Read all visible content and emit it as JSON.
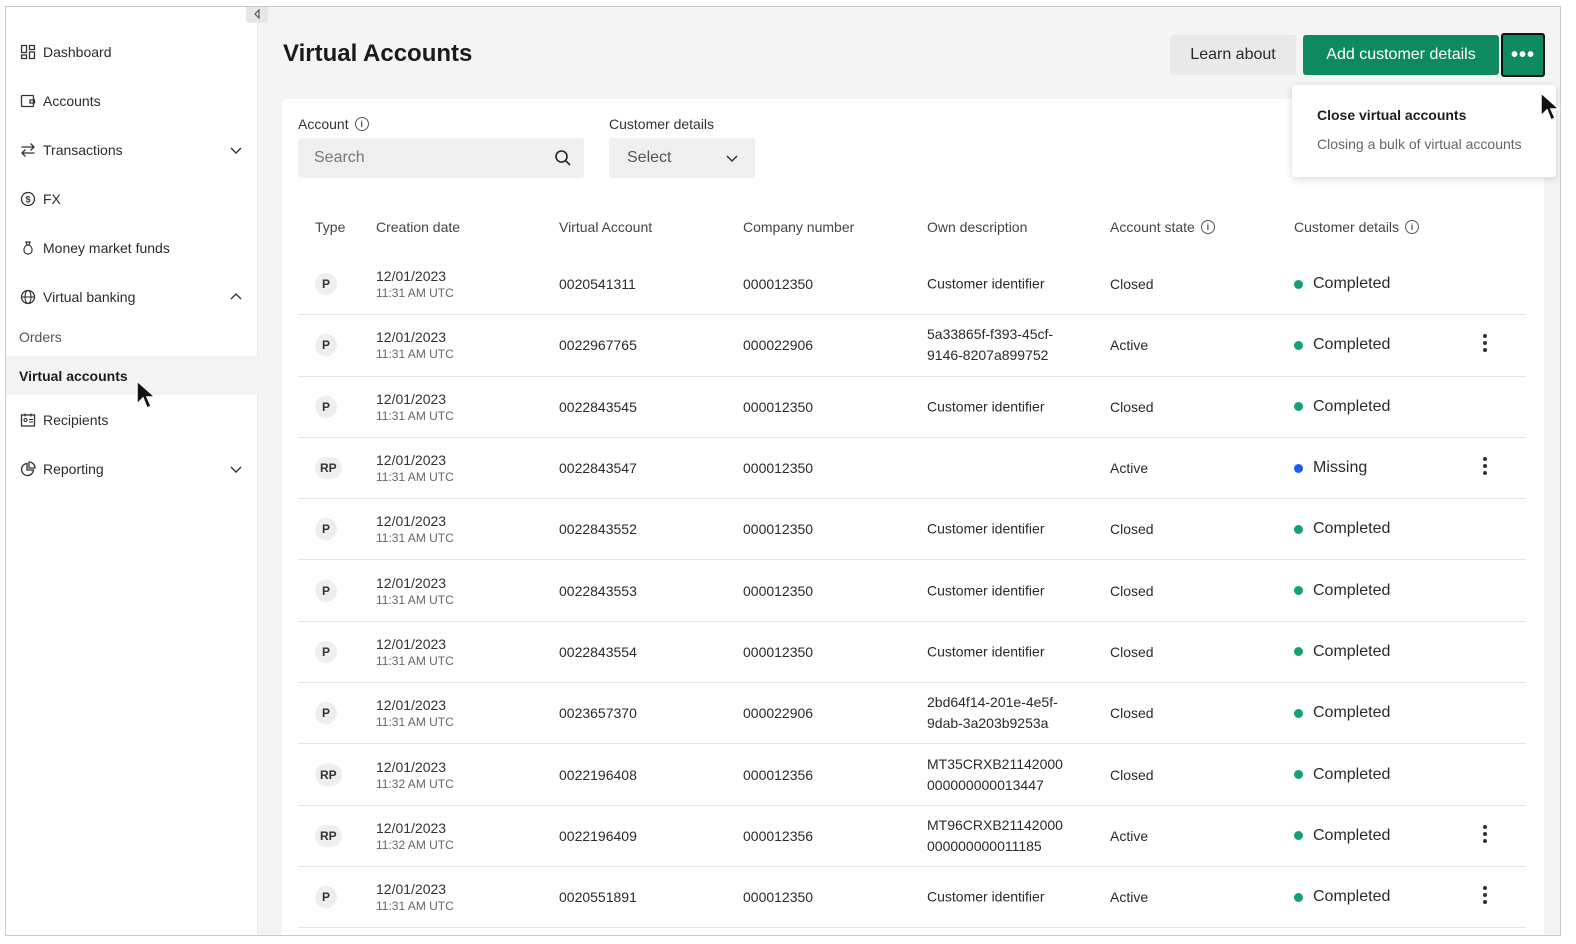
{
  "sidebar": {
    "items": [
      {
        "label": "Dashboard",
        "icon": "dashboard-icon"
      },
      {
        "label": "Accounts",
        "icon": "wallet-icon"
      },
      {
        "label": "Transactions",
        "icon": "transfer-arrows-icon",
        "chevron": "down"
      },
      {
        "label": "FX",
        "icon": "dollar-circle-icon"
      },
      {
        "label": "Money market funds",
        "icon": "money-bag-icon"
      },
      {
        "label": "Virtual banking",
        "icon": "globe-icon",
        "chevron": "up"
      }
    ],
    "sub_items": [
      {
        "label": "Orders"
      },
      {
        "label": "Virtual accounts",
        "active": true
      }
    ],
    "items_after": [
      {
        "label": "Recipients",
        "icon": "contact-card-icon"
      },
      {
        "label": "Reporting",
        "icon": "pie-chart-icon",
        "chevron": "down"
      }
    ]
  },
  "header": {
    "title": "Virtual Accounts",
    "learn_label": "Learn about",
    "add_label": "Add customer details",
    "more_label": "•••"
  },
  "dropdown": {
    "title": "Close virtual accounts",
    "description": "Closing a bulk of virtual accounts"
  },
  "filters": {
    "account_label": "Account",
    "search_placeholder": "Search",
    "customer_label": "Customer details",
    "customer_value": "Select"
  },
  "table": {
    "columns": [
      "Type",
      "Creation date",
      "Virtual Account",
      "Company number",
      "Own description",
      "Account state",
      "Customer details"
    ],
    "rows": [
      {
        "type": "P",
        "date": "12/01/2023",
        "time": "11:31 AM UTC",
        "account": "0020541311",
        "company": "000012350",
        "desc1": "Customer identifier",
        "desc2": "",
        "state": "Closed",
        "details": "Completed",
        "status": "completed",
        "menu": false
      },
      {
        "type": "P",
        "date": "12/01/2023",
        "time": "11:31 AM UTC",
        "account": "0022967765",
        "company": "000022906",
        "desc1": "5a33865f-f393-45cf-",
        "desc2": "9146-8207a899752",
        "state": "Active",
        "details": "Completed",
        "status": "completed",
        "menu": true
      },
      {
        "type": "P",
        "date": "12/01/2023",
        "time": "11:31 AM UTC",
        "account": "0022843545",
        "company": "000012350",
        "desc1": "Customer identifier",
        "desc2": "",
        "state": "Closed",
        "details": "Completed",
        "status": "completed",
        "menu": false
      },
      {
        "type": "RP",
        "date": "12/01/2023",
        "time": "11:31 AM UTC",
        "account": "0022843547",
        "company": "000012350",
        "desc1": "",
        "desc2": "",
        "state": "Active",
        "details": "Missing",
        "status": "missing",
        "menu": true
      },
      {
        "type": "P",
        "date": "12/01/2023",
        "time": "11:31 AM UTC",
        "account": "0022843552",
        "company": "000012350",
        "desc1": "Customer identifier",
        "desc2": "",
        "state": "Closed",
        "details": "Completed",
        "status": "completed",
        "menu": false
      },
      {
        "type": "P",
        "date": "12/01/2023",
        "time": "11:31 AM UTC",
        "account": "0022843553",
        "company": "000012350",
        "desc1": "Customer identifier",
        "desc2": "",
        "state": "Closed",
        "details": "Completed",
        "status": "completed",
        "menu": false
      },
      {
        "type": "P",
        "date": "12/01/2023",
        "time": "11:31 AM UTC",
        "account": "0022843554",
        "company": "000012350",
        "desc1": "Customer identifier",
        "desc2": "",
        "state": "Closed",
        "details": "Completed",
        "status": "completed",
        "menu": false
      },
      {
        "type": "P",
        "date": "12/01/2023",
        "time": "11:31 AM UTC",
        "account": "0023657370",
        "company": "000022906",
        "desc1": "2bd64f14-201e-4e5f-",
        "desc2": "9dab-3a203b9253a",
        "state": "Closed",
        "details": "Completed",
        "status": "completed",
        "menu": false
      },
      {
        "type": "RP",
        "date": "12/01/2023",
        "time": "11:32 AM UTC",
        "account": "0022196408",
        "company": "000012356",
        "desc1": "MT35CRXB21142000",
        "desc2": "000000000013447",
        "state": "Closed",
        "details": "Completed",
        "status": "completed",
        "menu": false
      },
      {
        "type": "RP",
        "date": "12/01/2023",
        "time": "11:32 AM UTC",
        "account": "0022196409",
        "company": "000012356",
        "desc1": "MT96CRXB21142000",
        "desc2": "000000000011185",
        "state": "Active",
        "details": "Completed",
        "status": "completed",
        "menu": true
      },
      {
        "type": "P",
        "date": "12/01/2023",
        "time": "11:31 AM UTC",
        "account": "0020551891",
        "company": "000012350",
        "desc1": "Customer identifier",
        "desc2": "",
        "state": "Active",
        "details": "Completed",
        "status": "completed",
        "menu": true
      }
    ]
  },
  "colors": {
    "accent": "#0d8a60",
    "completed": "#14a16b",
    "missing": "#1f5bf0"
  },
  "icons": {
    "collapse": "chevron-left-icon",
    "info": "info-icon",
    "search": "search-icon",
    "select_chevron": "chevron-down-icon",
    "row_menu": "kebab-menu-icon",
    "cursor": "mouse-pointer-icon"
  }
}
